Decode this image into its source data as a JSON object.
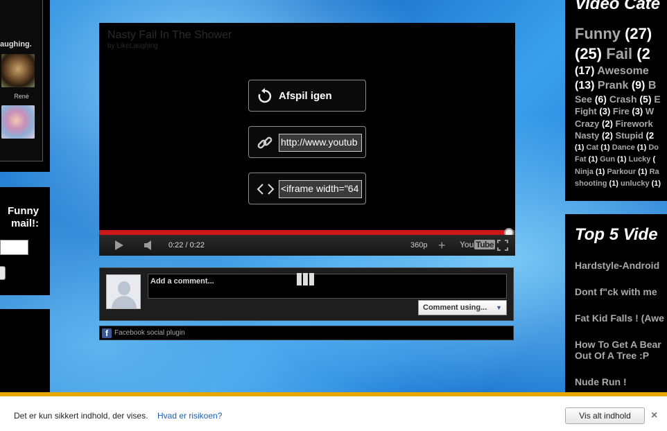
{
  "left_sidebar": {
    "top_text": "aughing.",
    "user1_name": "René",
    "user2_name": "",
    "subscribe_title_line1": "Funny",
    "subscribe_title_line2": "mail!:"
  },
  "player": {
    "title": "Nasty Fail In The Shower",
    "byline": "by LikeLaughing",
    "replay_label": "Afspil igen",
    "share_url": "http://www.youtub",
    "embed_code": "<iframe width=\"64",
    "time": "0:22 / 0:22",
    "quality": "360p",
    "logo_you": "You",
    "logo_tube": "Tube",
    "progress": 1.0
  },
  "comments": {
    "placeholder": "Add a comment...",
    "comment_using": "Comment using...",
    "plugin_label": "Facebook social plugin"
  },
  "categories": {
    "heading": "Video Cate",
    "rows": [
      {
        "size": 22,
        "parts": [
          {
            "t": "Funny ",
            "tag": true
          },
          {
            "t": "(27)",
            "tag": false
          }
        ]
      },
      {
        "size": 22,
        "parts": [
          {
            "t": "(25) ",
            "tag": false
          },
          {
            "t": "Fail ",
            "tag": true
          },
          {
            "t": "(2",
            "tag": false
          }
        ]
      },
      {
        "size": 16,
        "parts": [
          {
            "t": "(17) ",
            "tag": false
          },
          {
            "t": "Awesome",
            "tag": true
          }
        ]
      },
      {
        "size": 16,
        "parts": [
          {
            "t": "(13) ",
            "tag": false
          },
          {
            "t": "Prank ",
            "tag": true
          },
          {
            "t": "(9) ",
            "tag": false
          },
          {
            "t": "B",
            "tag": true
          }
        ]
      },
      {
        "size": 14,
        "parts": [
          {
            "t": "See ",
            "tag": true
          },
          {
            "t": "(6) ",
            "tag": false
          },
          {
            "t": "Crash ",
            "tag": true
          },
          {
            "t": "(5) ",
            "tag": false
          },
          {
            "t": "E",
            "tag": true
          }
        ]
      },
      {
        "size": 13,
        "parts": [
          {
            "t": "Fight ",
            "tag": true
          },
          {
            "t": "(3) ",
            "tag": false
          },
          {
            "t": "Fire ",
            "tag": true
          },
          {
            "t": "(3) ",
            "tag": false
          },
          {
            "t": "W",
            "tag": true
          }
        ]
      },
      {
        "size": 13,
        "parts": [
          {
            "t": "Crazy ",
            "tag": true
          },
          {
            "t": "(2) ",
            "tag": false
          },
          {
            "t": "Firework",
            "tag": true
          }
        ]
      },
      {
        "size": 13,
        "parts": [
          {
            "t": "Nasty ",
            "tag": true
          },
          {
            "t": "(2) ",
            "tag": false
          },
          {
            "t": "Stupid ",
            "tag": true
          },
          {
            "t": "(2",
            "tag": false
          }
        ]
      },
      {
        "size": 11,
        "parts": [
          {
            "t": "(1) ",
            "tag": false
          },
          {
            "t": "Cat ",
            "tag": true
          },
          {
            "t": "(1) ",
            "tag": false
          },
          {
            "t": "Dance ",
            "tag": true
          },
          {
            "t": "(1) ",
            "tag": false
          },
          {
            "t": "Do",
            "tag": true
          }
        ]
      },
      {
        "size": 11,
        "parts": [
          {
            "t": "Fat ",
            "tag": true
          },
          {
            "t": "(1) ",
            "tag": false
          },
          {
            "t": "Gun ",
            "tag": true
          },
          {
            "t": "(1) ",
            "tag": false
          },
          {
            "t": "Lucky ",
            "tag": true
          },
          {
            "t": "(",
            "tag": false
          }
        ]
      },
      {
        "size": 11,
        "parts": [
          {
            "t": "Ninja ",
            "tag": true
          },
          {
            "t": "(1) ",
            "tag": false
          },
          {
            "t": "Parkour ",
            "tag": true
          },
          {
            "t": "(1) ",
            "tag": false
          },
          {
            "t": "Ra",
            "tag": true
          }
        ]
      },
      {
        "size": 11,
        "parts": [
          {
            "t": "shooting ",
            "tag": true
          },
          {
            "t": "(1) ",
            "tag": false
          },
          {
            "t": "unlucky ",
            "tag": true
          },
          {
            "t": "(1)",
            "tag": false
          }
        ]
      }
    ]
  },
  "top5": {
    "heading": "Top 5 Vide",
    "items": [
      "Hardstyle-Android",
      "Dont f\"ck with me",
      "Fat Kid Falls ! (Awe",
      "How To Get A Bear Out Of A Tree :P",
      "Nude Run !"
    ]
  },
  "notification": {
    "message": "Det er kun sikkert indhold, der vises.",
    "link": "Hvad er risikoen?",
    "button": "Vis alt indhold",
    "close": "×"
  }
}
